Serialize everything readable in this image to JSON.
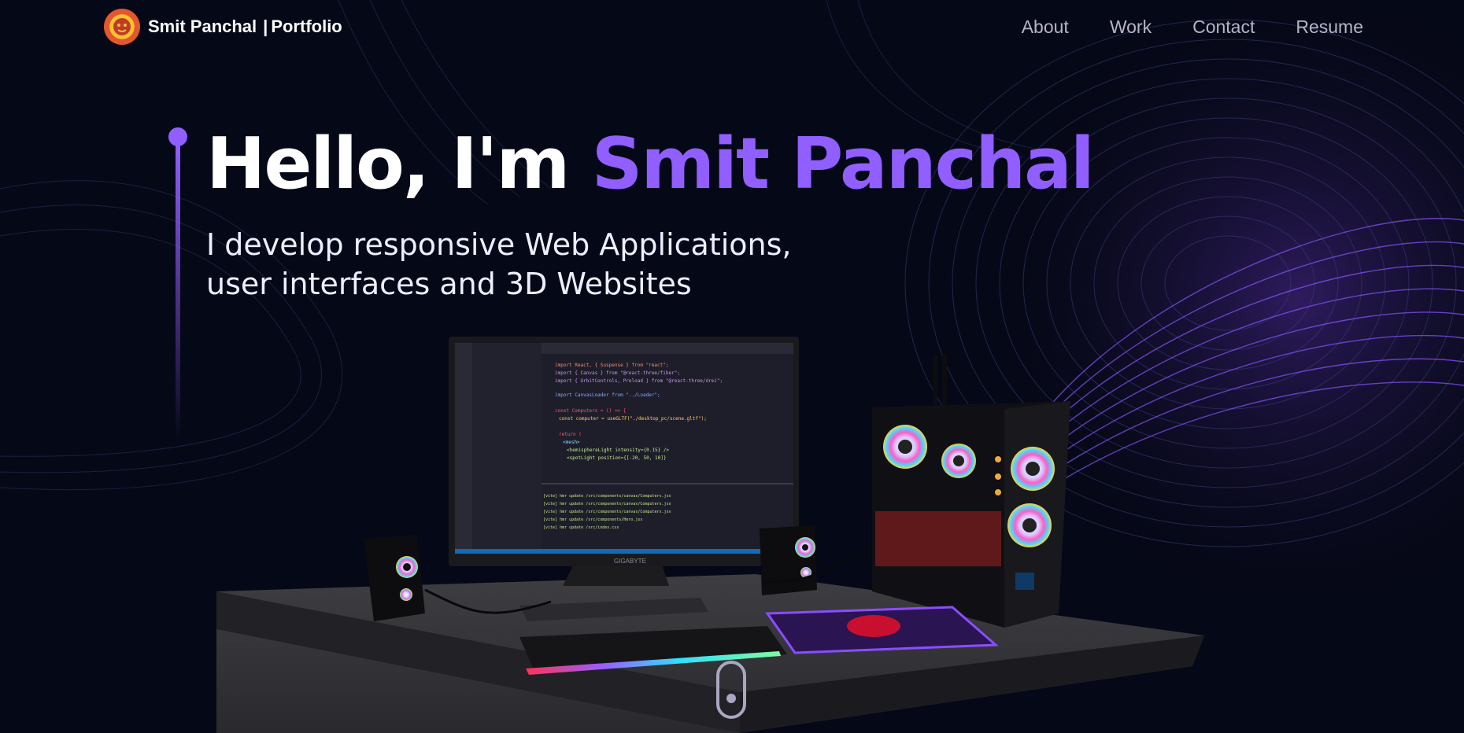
{
  "brand": {
    "name": "Smit Panchal",
    "suffix": "Portfolio",
    "separator": "|"
  },
  "nav": {
    "links": [
      "About",
      "Work",
      "Contact",
      "Resume"
    ]
  },
  "hero": {
    "greeting": "Hello, I'm",
    "name": "Smit Panchal",
    "line1": "I develop responsive Web Applications,",
    "line2": "user interfaces and 3D Websites"
  },
  "monitor_brand": "GIGABYTE",
  "colors": {
    "accent": "#915eff",
    "background": "#050816",
    "nav_text": "#b6b4c6"
  }
}
